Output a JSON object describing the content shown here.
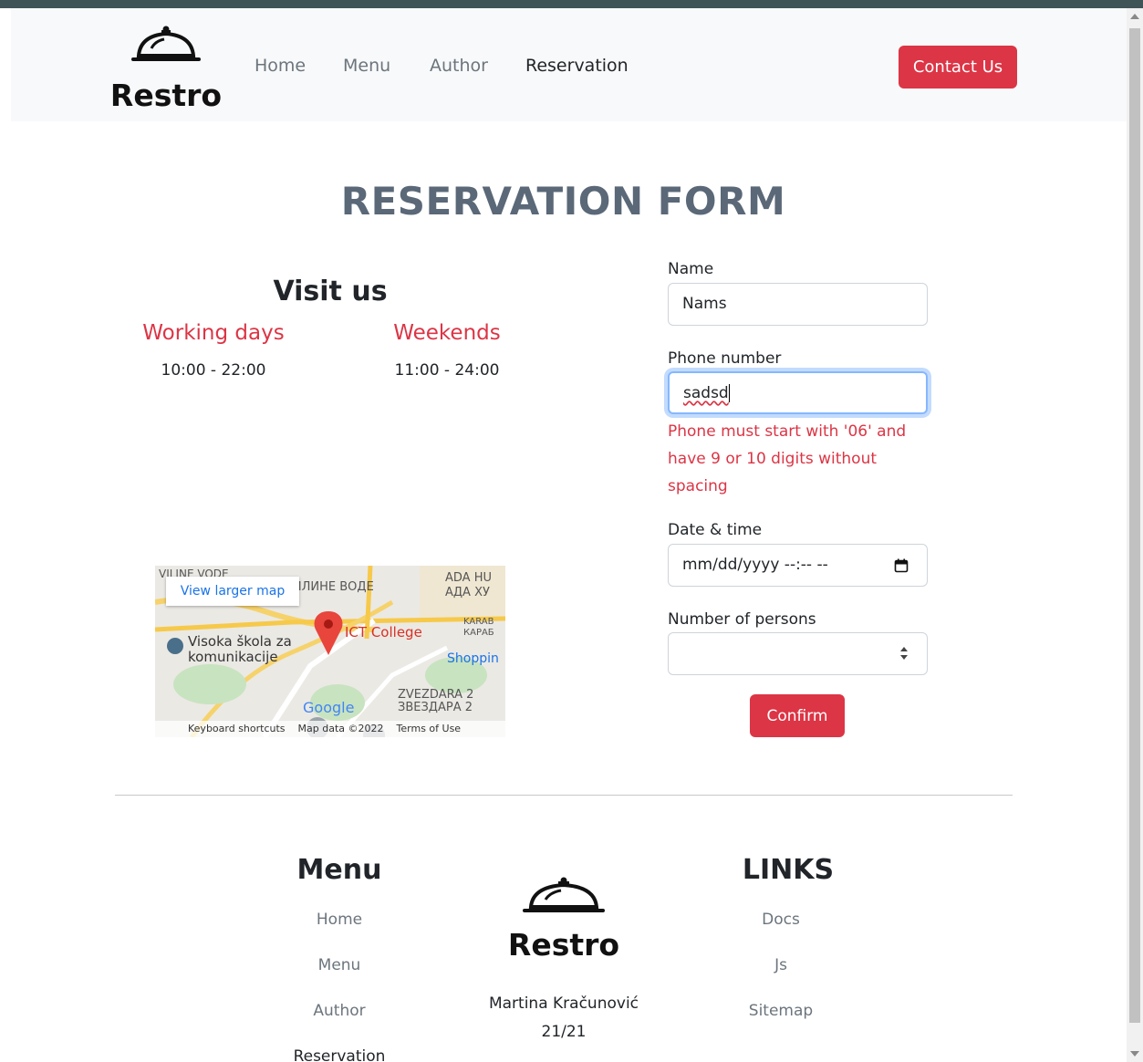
{
  "brand": {
    "name": "Restro"
  },
  "nav": {
    "links": [
      "Home",
      "Menu",
      "Author",
      "Reservation"
    ],
    "active": "Reservation",
    "contact_label": "Contact Us"
  },
  "page_title": "RESERVATION FORM",
  "visit": {
    "title": "Visit us",
    "working_days": {
      "label": "Working days",
      "hours": "10:00 - 22:00"
    },
    "weekends": {
      "label": "Weekends",
      "hours": "11:00 - 24:00"
    }
  },
  "map": {
    "view_larger": "View larger map",
    "pin_label": "ICT College",
    "labels": [
      "VILINE VODE",
      "ВИЛИНЕ ВОДЕ",
      "ADA HU",
      "АДА ХУ",
      "KARAB",
      "КАРАБ",
      "Visoka škola za",
      "komunikacije",
      "Shoppin",
      "ZVEZDARA 2",
      "ЗВЕЗДАРА 2",
      "Google"
    ],
    "footer": [
      "Keyboard shortcuts",
      "Map data ©2022",
      "Terms of Use"
    ]
  },
  "form": {
    "name": {
      "label": "Name",
      "value": "Nams"
    },
    "phone": {
      "label": "Phone number",
      "value": "sadsd",
      "error": "Phone must start with '06' and have 9 or 10 digits without spacing"
    },
    "datetime": {
      "label": "Date & time",
      "placeholder": "mm/dd/yyyy --:-- --"
    },
    "persons": {
      "label": "Number of persons",
      "value": ""
    },
    "confirm_label": "Confirm"
  },
  "footer": {
    "menu": {
      "title": "Menu",
      "links": [
        "Home",
        "Menu",
        "Author",
        "Reservation"
      ]
    },
    "links": {
      "title": "LINKS",
      "links": [
        "Docs",
        "Js",
        "Sitemap"
      ]
    },
    "author": "Martina Kračunović",
    "author_id": "21/21"
  },
  "colors": {
    "accent": "#dc3545",
    "title": "#5a6878",
    "nav_bg": "#f8f9fa",
    "topbar": "#3f5457"
  }
}
